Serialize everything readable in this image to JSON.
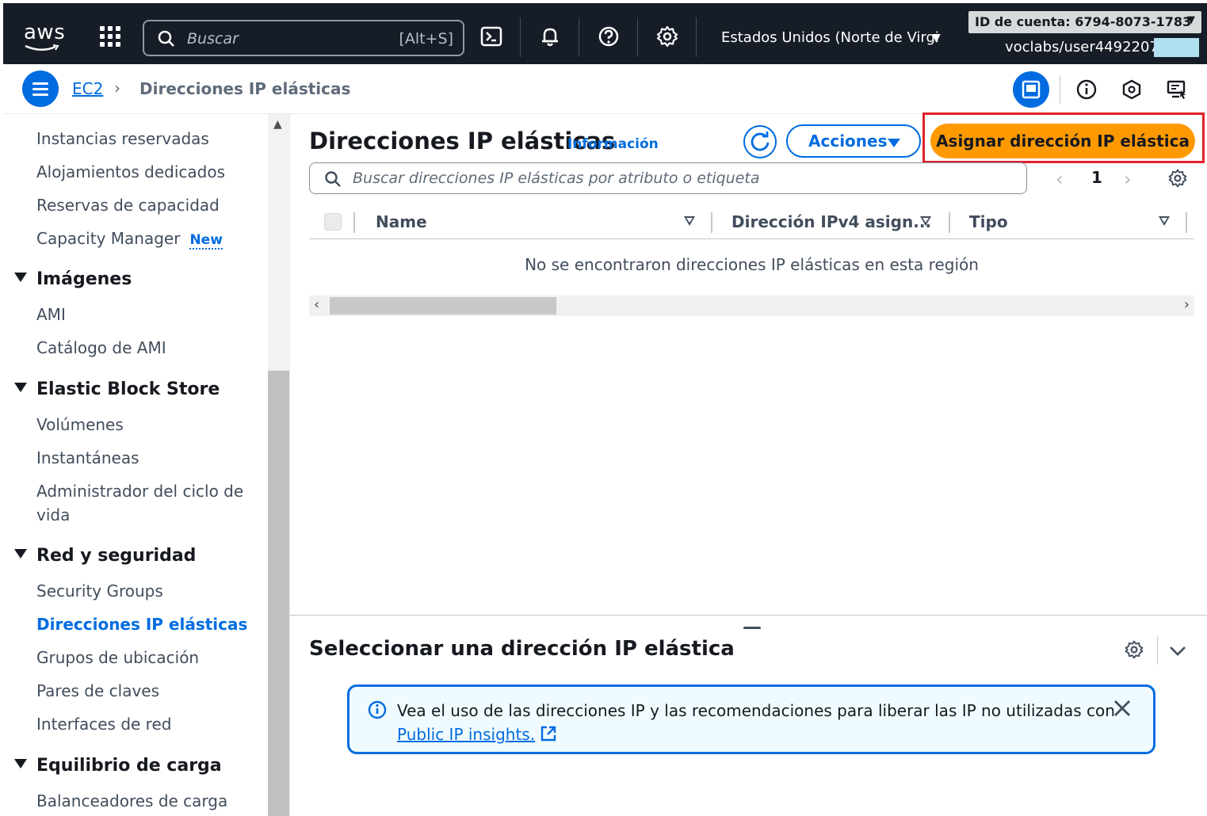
{
  "topbar": {
    "logo": "aws",
    "search_placeholder": "Buscar",
    "search_shortcut": "[Alt+S]",
    "icons": [
      "cloudshell-icon",
      "bell-icon",
      "help-icon",
      "gear-icon"
    ],
    "region": "Estados Unidos (Norte de Virgi",
    "account_id": "ID de cuenta: 6794-8073-1783",
    "user": "voclabs/user4492207="
  },
  "breadcrumb": {
    "service": "EC2",
    "current": "Direcciones IP elásticas"
  },
  "sidebar": {
    "items_top": [
      "Instancias reservadas",
      "Alojamientos dedicados",
      "Reservas de capacidad",
      "Capacity Manager"
    ],
    "new_badge": "New",
    "sections": [
      {
        "title": "Imágenes",
        "items": [
          "AMI",
          "Catálogo de AMI"
        ]
      },
      {
        "title": "Elastic Block Store",
        "items": [
          "Volúmenes",
          "Instantáneas",
          "Administrador del ciclo de",
          "vida"
        ]
      },
      {
        "title": "Red y seguridad",
        "items": [
          "Security Groups",
          "Direcciones IP elásticas",
          "Grupos de ubicación",
          "Pares de claves",
          "Interfaces de red"
        ]
      },
      {
        "title": "Equilibrio de carga",
        "items": [
          "Balanceadores de carga"
        ]
      }
    ],
    "active_item": "Direcciones IP elásticas"
  },
  "main": {
    "title": "Direcciones IP elásticas",
    "info": "Información",
    "actions_label": "Acciones",
    "primary_label": "Asignar dirección IP elástica",
    "filter_placeholder": "Buscar direcciones IP elásticas por atributo o etiqueta",
    "page": "1",
    "columns": [
      "Name",
      "Dirección IPv4 asign...",
      "Tipo"
    ],
    "empty": "No se encontraron direcciones IP elásticas en esta región"
  },
  "split": {
    "title": "Seleccionar una dirección IP elástica",
    "alert_text": "Vea el uso de las direcciones IP y las recomendaciones para liberar las IP no utilizadas con",
    "alert_link": "Public IP insights."
  },
  "colors": {
    "nav_bg": "#161d26",
    "accent": "#006ce0",
    "primary": "#ff9900",
    "highlight": "#e0212b"
  }
}
